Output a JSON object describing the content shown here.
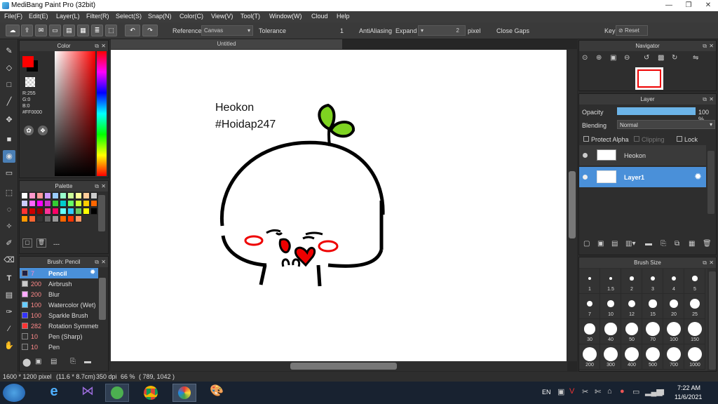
{
  "window": {
    "title": "MediBang Paint Pro (32bit)"
  },
  "menu": [
    "File(F)",
    "Edit(E)",
    "Layer(L)",
    "Filter(R)",
    "Select(S)",
    "Snap(N)",
    "Color(C)",
    "View(V)",
    "Tool(T)",
    "Window(W)",
    "Cloud",
    "Help"
  ],
  "toolbar": {
    "reference_label": "Reference",
    "reference_value": "Canvas",
    "tolerance_label": "Tolerance",
    "tolerance_value": "1",
    "antialias_label": "AntiAliasing",
    "antialias_checked": true,
    "expand_label": "Expand",
    "expand_value": "2",
    "expand_unit": "pixel",
    "close_gaps_label": "Close Gaps",
    "key_label": "Key",
    "reset_label": "Reset"
  },
  "color_panel": {
    "title": "Color",
    "r": "R:255",
    "g": "G:0",
    "b": "B:0",
    "hex": "#FF0000",
    "fg": "#ff0000",
    "bg": "#000000"
  },
  "palette_panel": {
    "title": "Palette",
    "colors": [
      "#ffffff",
      "#ff99cc",
      "#ff9999",
      "#cc99ff",
      "#99ccff",
      "#99ffcc",
      "#ccff99",
      "#ffff99",
      "#ffcc99",
      "#cccccc",
      "#ccccff",
      "#ff66ff",
      "#ff00ff",
      "#cc33cc",
      "#33cc33",
      "#00cccc",
      "#66ff66",
      "#ccff33",
      "#ffcc00",
      "#ff6600",
      "#ff3333",
      "#cc0000",
      "#990000",
      "#ff3399",
      "#ff0066",
      "#66ffff",
      "#33ccff",
      "#66cc66",
      "#ffff00",
      "#000000",
      "#ff9900",
      "#ff6633",
      "#333333",
      "#666666",
      "#999999",
      "#ff6600",
      "#ff3300",
      "#ff9966"
    ],
    "footer_text": "---"
  },
  "brush_panel": {
    "title": "Brush: Pencil",
    "items": [
      {
        "size": "7",
        "name": "Pencil",
        "color": "#222244",
        "active": true
      },
      {
        "size": "200",
        "name": "Airbrush",
        "color": "#cccccc",
        "active": false
      },
      {
        "size": "200",
        "name": "Blur",
        "color": "#ffaaff",
        "active": false
      },
      {
        "size": "100",
        "name": "Watercolor (Wet)",
        "color": "#66ccff",
        "active": false
      },
      {
        "size": "100",
        "name": "Sparkle Brush",
        "color": "#3333ff",
        "active": false
      },
      {
        "size": "282",
        "name": "Rotation Symmetry",
        "color": "#ff3333",
        "active": false
      },
      {
        "size": "10",
        "name": "Pen (Sharp)",
        "color": "#333333",
        "active": false
      },
      {
        "size": "10",
        "name": "Pen",
        "color": "#333333",
        "active": false
      }
    ]
  },
  "document": {
    "tab_title": "Untitled",
    "text_line1": "Heokon",
    "text_line2": "#Hoidap247"
  },
  "navigator": {
    "title": "Navigator"
  },
  "layer_panel": {
    "title": "Layer",
    "opacity_label": "Opacity",
    "opacity_value": "100 %",
    "opacity_fraction": 1.0,
    "blending_label": "Blending",
    "blending_value": "Normal",
    "protect_alpha": "Protect Alpha",
    "clipping": "Clipping",
    "lock": "Lock",
    "layers": [
      {
        "name": "Heokon",
        "selected": false
      },
      {
        "name": "Layer1",
        "selected": true
      }
    ]
  },
  "brush_size_panel": {
    "title": "Brush Size",
    "sizes": [
      "1",
      "1.5",
      "2",
      "3",
      "4",
      "5",
      "7",
      "10",
      "12",
      "15",
      "20",
      "25",
      "30",
      "40",
      "50",
      "70",
      "100",
      "150",
      "200",
      "300",
      "400",
      "500",
      "700",
      "1000"
    ]
  },
  "status": {
    "dimensions": "1600 * 1200 pixel",
    "physical": "(11.6 * 8.7cm)",
    "dpi": "350 dpi",
    "zoom": "66 %",
    "cursor": "( 789, 1042 )"
  },
  "taskbar": {
    "language": "EN",
    "time": "7:22 AM",
    "date": "11/6/2021"
  }
}
